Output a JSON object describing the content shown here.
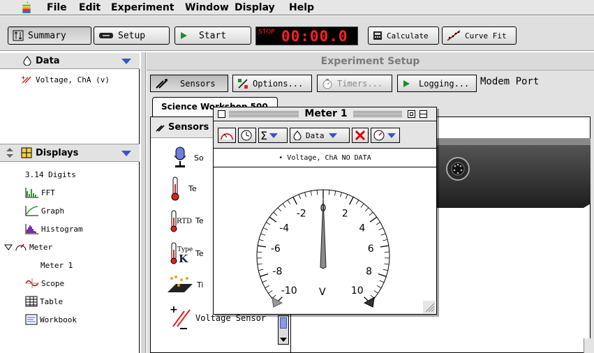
{
  "menu": {
    "apple_icon": "apple-logo-icon",
    "items": [
      "File",
      "Edit",
      "Experiment",
      "Window",
      "Display",
      "Help"
    ]
  },
  "toolbar": {
    "summary_label": "Summary",
    "setup_label": "Setup",
    "start_label": "Start",
    "stop_label": "STOP",
    "timer": "00:00.0",
    "calculate_label": "Calculate",
    "curvefit_label": "Curve Fit"
  },
  "data_pane": {
    "title": "Data",
    "items": [
      "Voltage, ChA (v)"
    ]
  },
  "displays_pane": {
    "title": "Displays",
    "items": [
      {
        "label": "3.14 Digits",
        "icon": "digits-icon"
      },
      {
        "label": "FFT",
        "icon": "fft-icon"
      },
      {
        "label": "Graph",
        "icon": "graph-icon"
      },
      {
        "label": "Histogram",
        "icon": "histogram-icon"
      },
      {
        "label": "Meter",
        "icon": "meter-icon"
      },
      {
        "label": "Meter 1",
        "icon": ""
      },
      {
        "label": "Scope",
        "icon": "scope-icon"
      },
      {
        "label": "Table",
        "icon": "table-icon"
      },
      {
        "label": "Workbook",
        "icon": "workbook-icon"
      }
    ]
  },
  "experiment": {
    "title": "Experiment Setup",
    "buttons": {
      "sensors": "Sensors",
      "options": "Options...",
      "timers": "Timers...",
      "logging": "Logging..."
    },
    "port": "Modem Port",
    "tab": "Science Workshop 500",
    "sensors_header": "Sensors",
    "sensor_list": [
      {
        "label": "So",
        "icon": "microphone-sensor-icon"
      },
      {
        "label": "Te",
        "icon": "thermometer-icon"
      },
      {
        "label": "Te",
        "icon": "rtd-thermometer-icon"
      },
      {
        "label": "Te",
        "icon": "type-k-thermometer-icon"
      },
      {
        "label": "Ti",
        "icon": "time-photogate-icon"
      },
      {
        "label": "Voltage Sensor",
        "icon": "voltage-sensor-icon"
      }
    ]
  },
  "meter_window": {
    "title": "Meter 1",
    "data_button": "Data",
    "legend": "• Voltage, ChA   NO DATA",
    "unit": "V",
    "scale_labels": [
      "-10",
      "-8",
      "-6",
      "-4",
      "-2",
      "0",
      "2",
      "4",
      "6",
      "8",
      "10"
    ],
    "needle_value": 0
  }
}
